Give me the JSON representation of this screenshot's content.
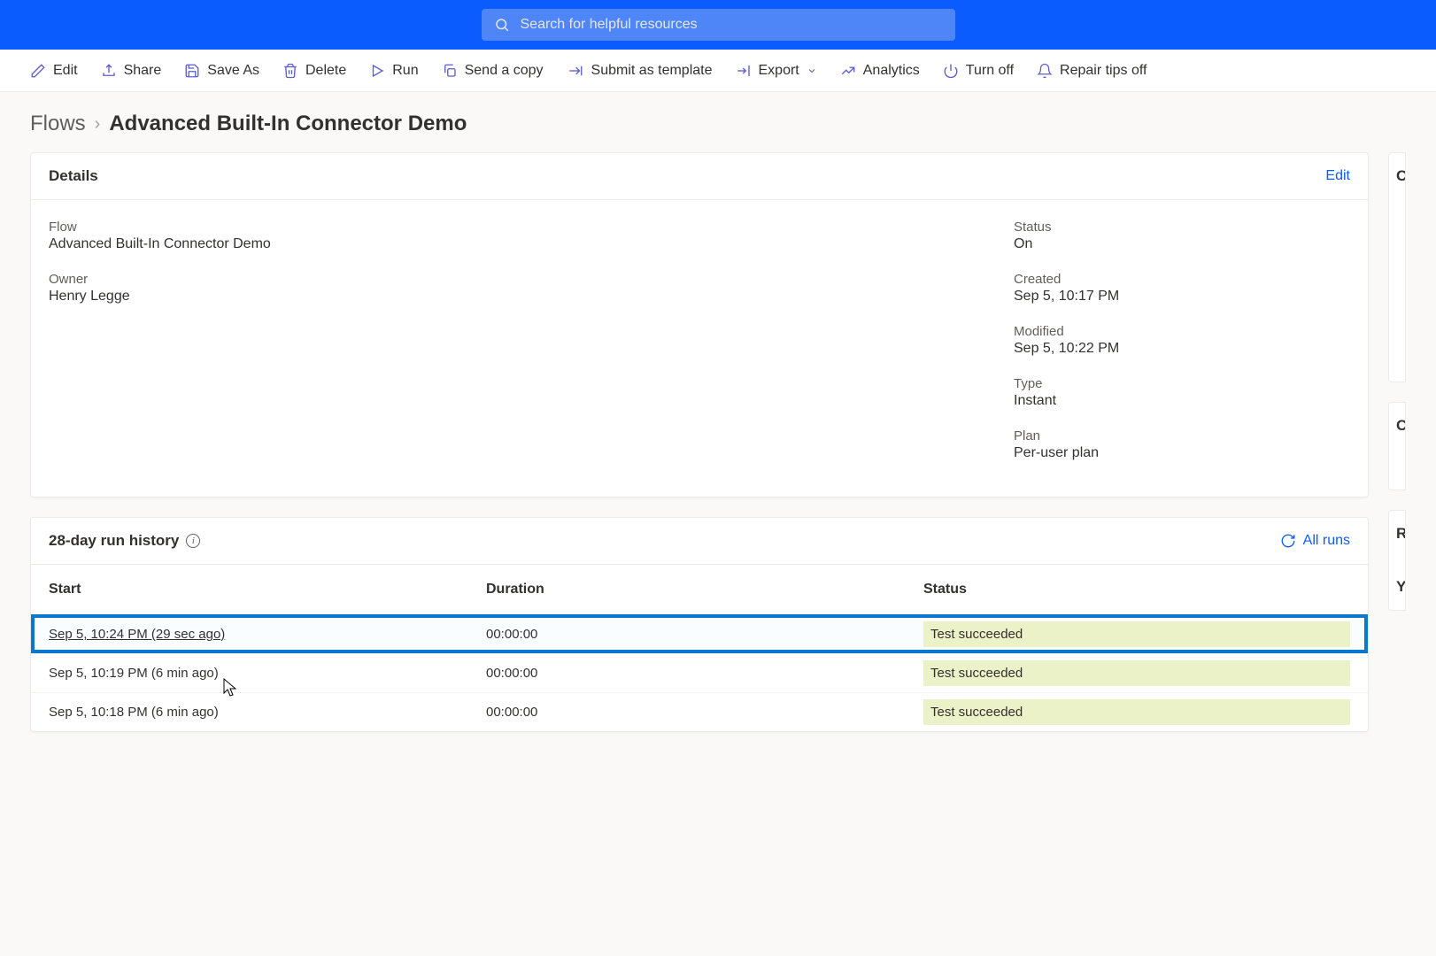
{
  "search": {
    "placeholder": "Search for helpful resources"
  },
  "commands": {
    "edit": "Edit",
    "share": "Share",
    "save_as": "Save As",
    "delete": "Delete",
    "run": "Run",
    "send_copy": "Send a copy",
    "submit_template": "Submit as template",
    "export": "Export",
    "analytics": "Analytics",
    "turn_off": "Turn off",
    "repair_tips": "Repair tips off"
  },
  "breadcrumb": {
    "root": "Flows",
    "current": "Advanced Built-In Connector Demo"
  },
  "details": {
    "card_title": "Details",
    "edit_link": "Edit",
    "fields": {
      "flow_label": "Flow",
      "flow_value": "Advanced Built-In Connector Demo",
      "owner_label": "Owner",
      "owner_value": "Henry Legge",
      "status_label": "Status",
      "status_value": "On",
      "created_label": "Created",
      "created_value": "Sep 5, 10:17 PM",
      "modified_label": "Modified",
      "modified_value": "Sep 5, 10:22 PM",
      "type_label": "Type",
      "type_value": "Instant",
      "plan_label": "Plan",
      "plan_value": "Per-user plan"
    }
  },
  "history": {
    "card_title": "28-day run history",
    "all_runs": "All runs",
    "columns": {
      "start": "Start",
      "duration": "Duration",
      "status": "Status"
    },
    "rows": [
      {
        "start": "Sep 5, 10:24 PM (29 sec ago)",
        "duration": "00:00:00",
        "status": "Test succeeded",
        "highlight": true
      },
      {
        "start": "Sep 5, 10:19 PM (6 min ago)",
        "duration": "00:00:00",
        "status": "Test succeeded",
        "highlight": false
      },
      {
        "start": "Sep 5, 10:18 PM (6 min ago)",
        "duration": "00:00:00",
        "status": "Test succeeded",
        "highlight": false
      }
    ]
  },
  "side_peek": {
    "c1": "C",
    "c2": "C",
    "r": "R",
    "y": "Y"
  }
}
